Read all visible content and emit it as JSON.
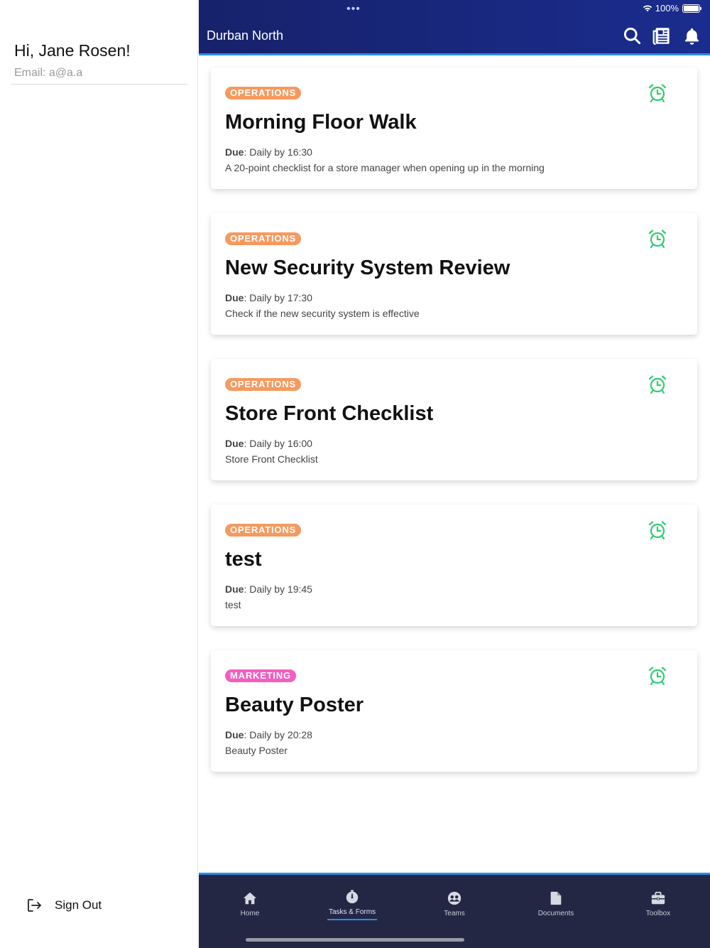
{
  "sidebar": {
    "greeting": "Hi, Jane Rosen!",
    "email_label": "Email: a@a.a",
    "signout_label": "Sign Out"
  },
  "status": {
    "dots": "•••",
    "battery": "100%"
  },
  "header": {
    "title": "Durban North",
    "icons": [
      "search-icon",
      "newspaper-icon",
      "bell-icon"
    ]
  },
  "colors": {
    "header": "#1a2a8a",
    "accent": "#2a8ee8",
    "operations_tag": "#f59a5f",
    "marketing_tag": "#f25fc0",
    "alarm": "#2ecc71",
    "tabbar": "#232744"
  },
  "cards": [
    {
      "tag": "OPERATIONS",
      "tag_color": "#f59a5f",
      "title": "Morning Floor Walk",
      "due_label": "Due",
      "due_value": ": Daily by 16:30",
      "description": "A 20-point checklist for a store manager when opening up in the morning"
    },
    {
      "tag": "OPERATIONS",
      "tag_color": "#f59a5f",
      "title": "New Security System Review",
      "due_label": "Due",
      "due_value": ": Daily by 17:30",
      "description": "Check if the new security system is effective"
    },
    {
      "tag": "OPERATIONS",
      "tag_color": "#f59a5f",
      "title": "Store Front Checklist",
      "due_label": "Due",
      "due_value": ": Daily by 16:00",
      "description": "Store Front Checklist"
    },
    {
      "tag": "OPERATIONS",
      "tag_color": "#f59a5f",
      "title": "test",
      "due_label": "Due",
      "due_value": ": Daily by 19:45",
      "description": "test"
    },
    {
      "tag": "MARKETING",
      "tag_color": "#f25fc0",
      "title": "Beauty Poster",
      "due_label": "Due",
      "due_value": ": Daily by 20:28",
      "description": "Beauty Poster"
    }
  ],
  "tabs": [
    {
      "label": "Home",
      "icon": "home-icon"
    },
    {
      "label": "Tasks & Forms",
      "icon": "stopwatch-icon",
      "active": true
    },
    {
      "label": "Teams",
      "icon": "teams-icon"
    },
    {
      "label": "Documents",
      "icon": "document-icon"
    },
    {
      "label": "Toolbox",
      "icon": "toolbox-icon"
    }
  ]
}
